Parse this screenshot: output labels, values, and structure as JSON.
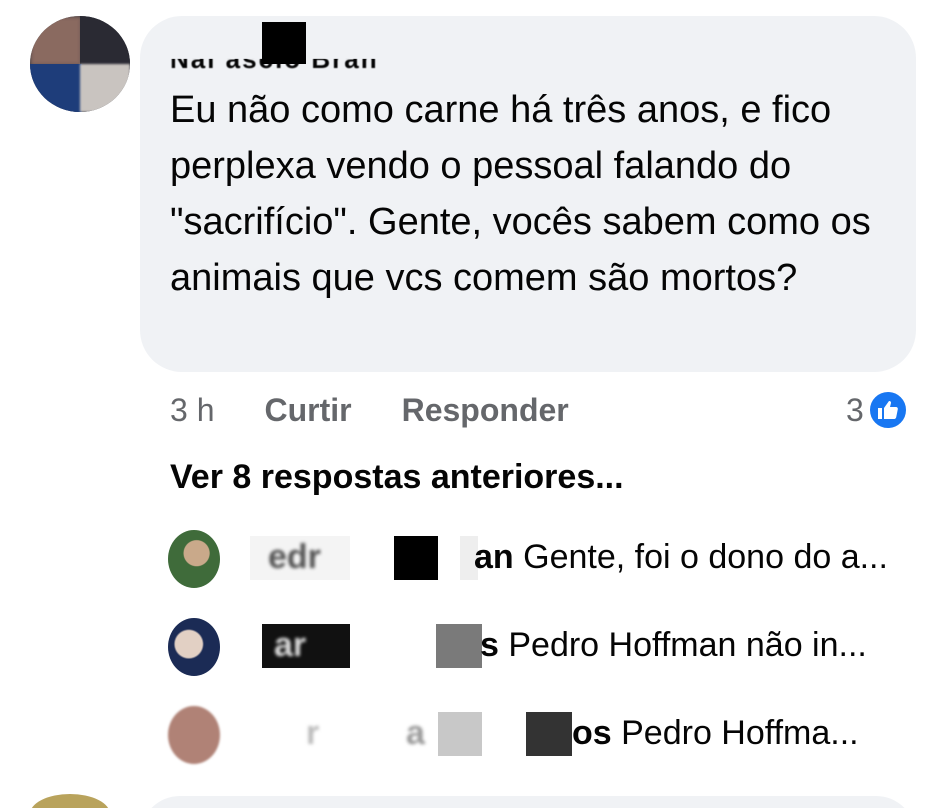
{
  "comment": {
    "author_partial": "Nai   ascio Bran",
    "text": "Eu não como carne há três anos, e fico perplexa vendo o pessoal falando do \"sacrifício\". Gente, vocês sabem como os animais que vcs comem são mortos?",
    "time": "3 h",
    "like_label": "Curtir",
    "reply_label": "Responder",
    "reaction_count": "3",
    "reaction_icon": "thumbs-up-icon",
    "reaction_color": "#1877f2"
  },
  "view_previous": "Ver 8 respostas anteriores...",
  "replies": [
    {
      "name_fragment_1": "edr",
      "name_fragment_2": "an",
      "text": " Gente, foi o dono do a..."
    },
    {
      "name_fragment_1": "ar",
      "name_fragment_2": "s",
      "text": " Pedro Hoffman não in..."
    },
    {
      "name_fragment_1": "r",
      "name_fragment_mid": "a",
      "name_fragment_2": "os",
      "text": " Pedro Hoffma..."
    }
  ]
}
